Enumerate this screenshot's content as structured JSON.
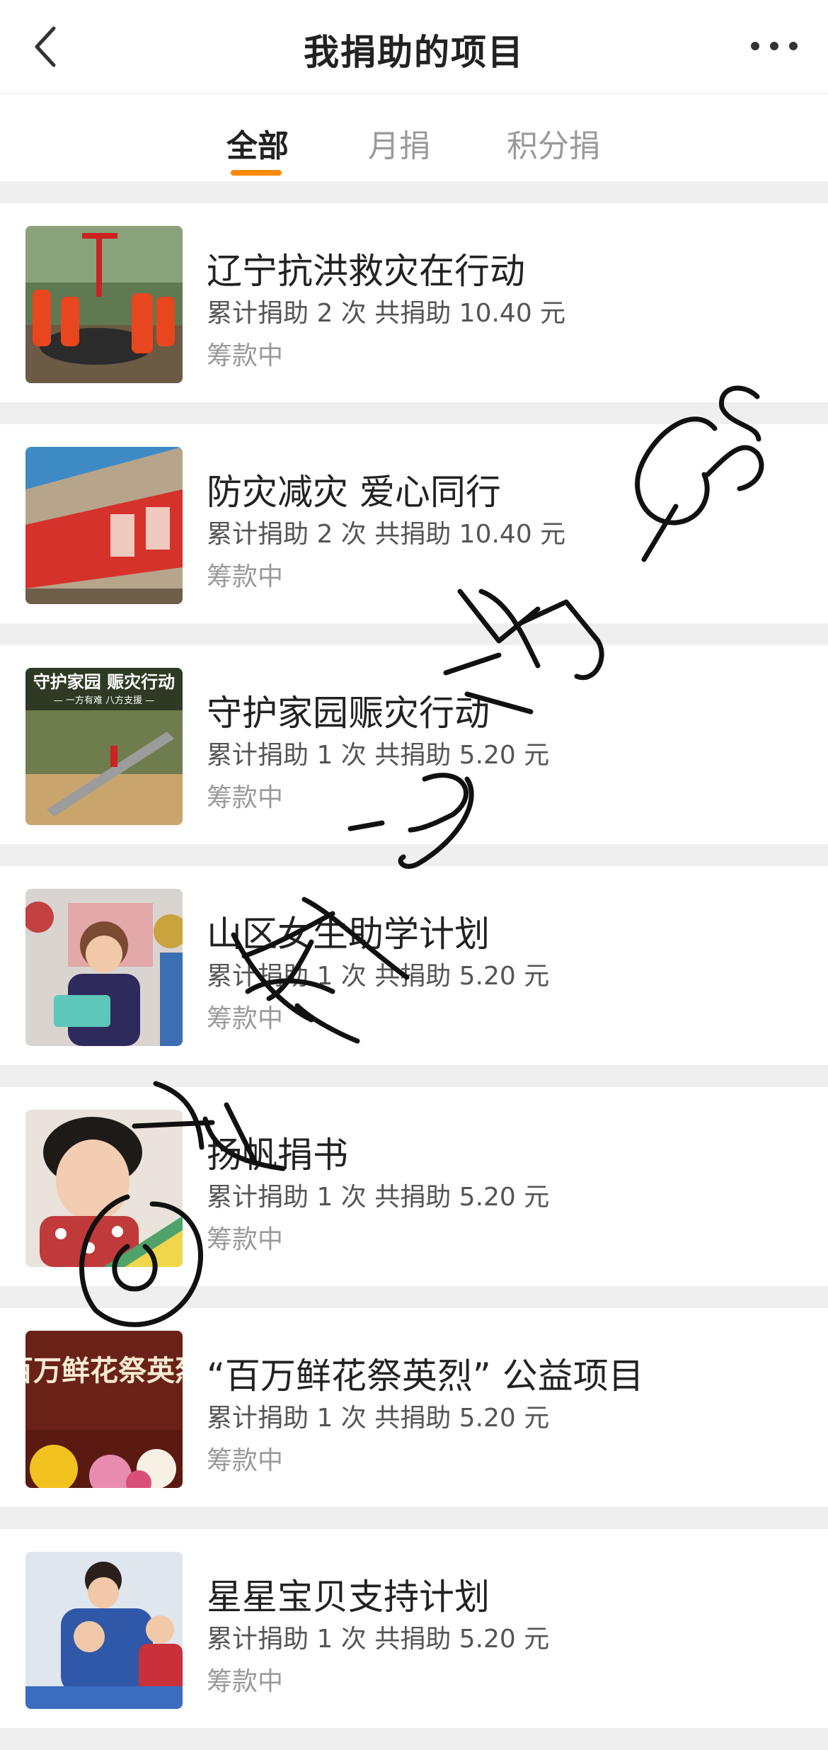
{
  "header": {
    "title": "我捐助的项目",
    "back_icon": "chevron-left-icon",
    "more_icon": "more-horizontal-icon"
  },
  "tabs": [
    {
      "label": "全部",
      "active": true
    },
    {
      "label": "月捐",
      "active": false
    },
    {
      "label": "积分捐",
      "active": false
    }
  ],
  "accent_color": "#ff8a00",
  "projects": [
    {
      "title": "辽宁抗洪救灾在行动",
      "stats": "累计捐助 2 次 共捐助 10.40 元",
      "status": "筹款中"
    },
    {
      "title": "防灾减灾 爱心同行",
      "stats": "累计捐助 2 次 共捐助 10.40 元",
      "status": "筹款中"
    },
    {
      "title": "守护家园赈灾行动",
      "stats": "累计捐助 1 次 共捐助 5.20 元",
      "status": "筹款中",
      "thumb_text": "守护家园 赈灾行动",
      "thumb_subtext": "— 一方有难 八方支援 —"
    },
    {
      "title": "山区女生助学计划",
      "stats": "累计捐助 1 次 共捐助 5.20 元",
      "status": "筹款中"
    },
    {
      "title": "扬帆捐书",
      "stats": "累计捐助 1 次 共捐助 5.20 元",
      "status": "筹款中"
    },
    {
      "title": "“百万鲜花祭英烈” 公益项目",
      "stats": "累计捐助 1 次 共捐助 5.20 元",
      "status": "筹款中",
      "thumb_text": "百万鲜花祭英烈"
    },
    {
      "title": "星星宝贝支持计划",
      "stats": "累计捐助 1 次 共捐助 5.20 元",
      "status": "筹款中"
    }
  ]
}
